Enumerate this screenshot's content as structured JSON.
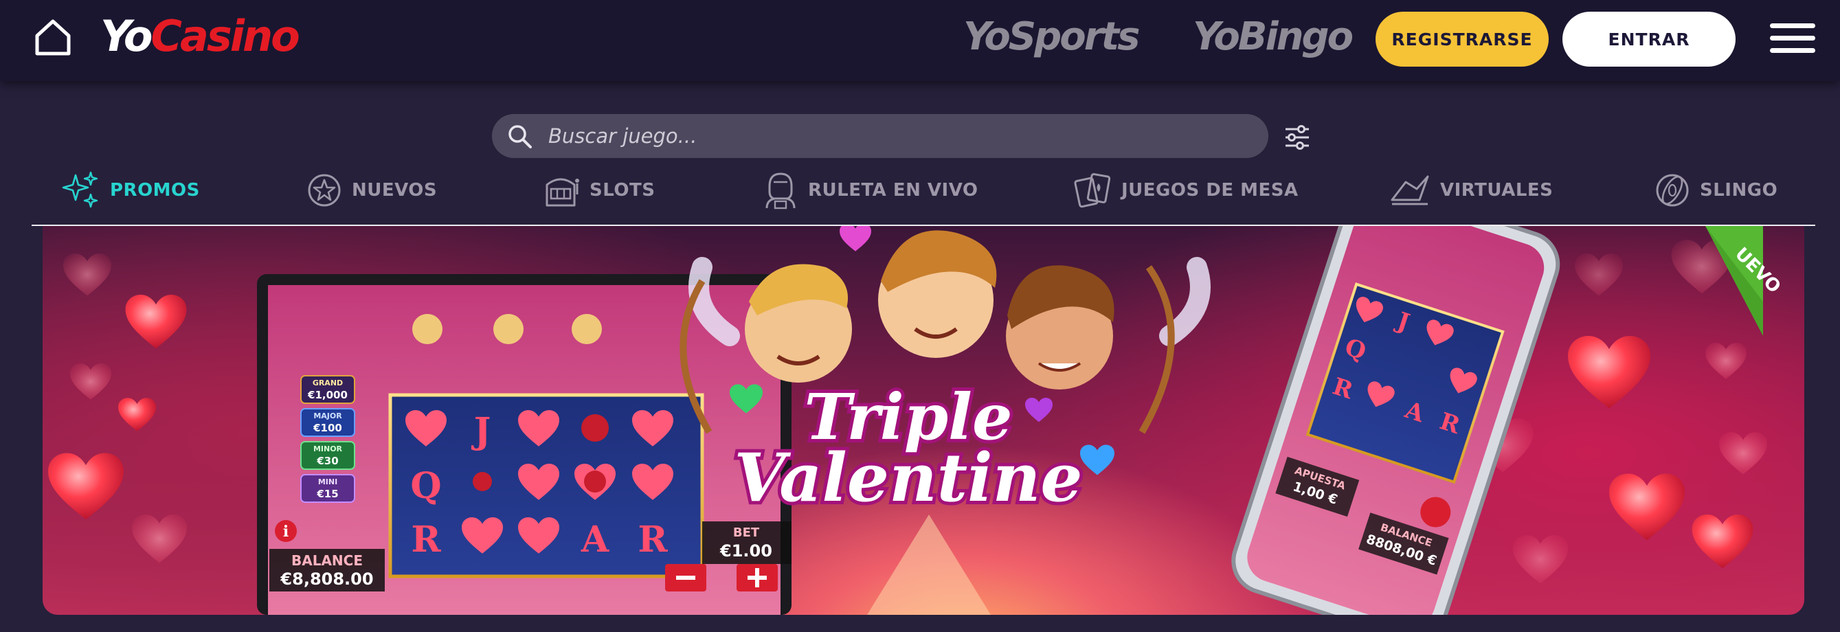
{
  "header": {
    "logo_yo": "Yo",
    "logo_casino": "Casino",
    "partner_sports": "YoSports",
    "partner_bingo": "YoBingo",
    "register_label": "REGISTRARSE",
    "login_label": "ENTRAR"
  },
  "search": {
    "placeholder": "Buscar juego..."
  },
  "nav": {
    "items": [
      {
        "label": "PROMOS",
        "icon": "sparkles-icon",
        "active": true
      },
      {
        "label": "NUEVOS",
        "icon": "new-star-badge-icon",
        "active": false
      },
      {
        "label": "SLOTS",
        "icon": "slot-machine-icon",
        "active": false
      },
      {
        "label": "RULETA EN VIVO",
        "icon": "live-dealer-icon",
        "active": false
      },
      {
        "label": "JUEGOS DE MESA",
        "icon": "playing-cards-icon",
        "active": false
      },
      {
        "label": "VIRTUALES",
        "icon": "virtual-sports-icon",
        "active": false
      },
      {
        "label": "SLINGO",
        "icon": "slingo-ball-icon",
        "active": false
      }
    ]
  },
  "banner": {
    "game_title_line1": "Triple",
    "game_title_line2": "Valentine",
    "corner_ribbon": "UEVO",
    "jackpots": [
      {
        "name": "GRAND",
        "value": "€1,000"
      },
      {
        "name": "MAJOR",
        "value": "€100"
      },
      {
        "name": "MINOR",
        "value": "€30"
      },
      {
        "name": "MINI",
        "value": "€15"
      }
    ],
    "balance_label": "BALANCE",
    "balance_value": "€8,808.00",
    "bet_label": "BET",
    "bet_value": "€1.00",
    "reel_symbols": [
      "",
      "J",
      "",
      "",
      "",
      "Q",
      "",
      "",
      "",
      "",
      "",
      "",
      "",
      "A",
      "R"
    ],
    "phone_bet_label": "APUESTA",
    "phone_bet_value": "1,00 €",
    "phone_balance_label": "BALANCE",
    "phone_balance_value": "8808,00 €"
  },
  "colors": {
    "header_bg": "#1a1630",
    "page_bg": "#26203b",
    "register_bg": "#f6c236",
    "active_nav": "#28d4cf",
    "nav_text": "#9d97a8",
    "brand_red": "#e51b24"
  }
}
